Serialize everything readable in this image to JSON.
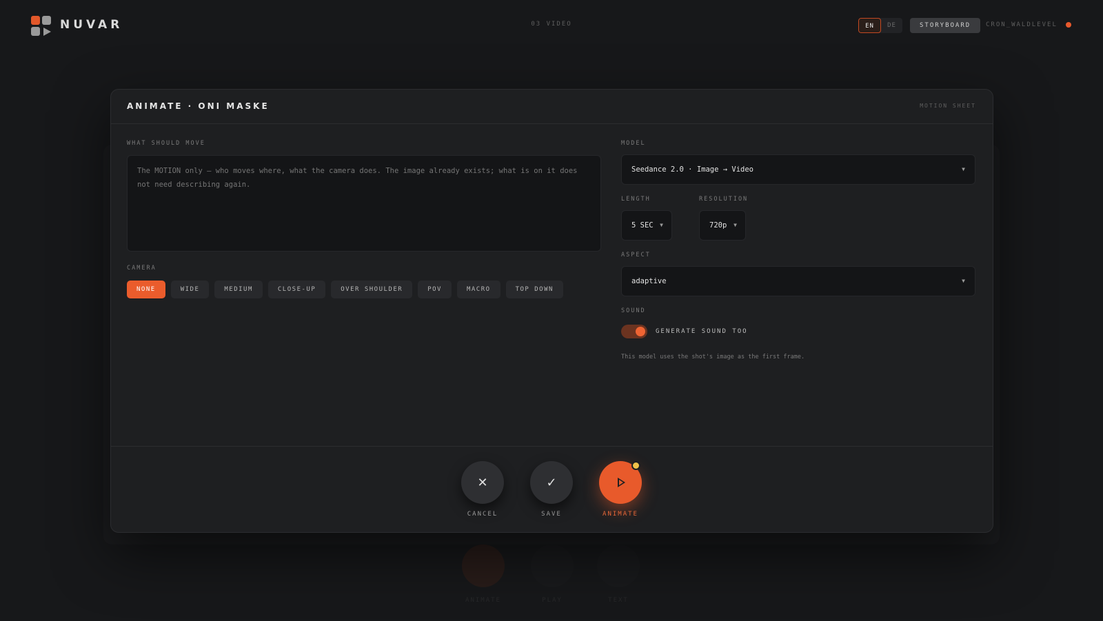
{
  "topbar": {
    "brand": "NUVAR",
    "crumb": "03 VIDEO",
    "lang_active": "EN",
    "lang_inactive": "DE",
    "storyboard_label": "STORYBOARD",
    "user": "CRON_WALDLEVEL",
    "accent": "#e8592c"
  },
  "modal": {
    "title": "ANIMATE · ONI MASKE",
    "tag": "MOTION SHEET",
    "motion_label": "WHAT SHOULD MOVE",
    "motion_placeholder": "The MOTION only — who moves where, what the camera does. The image already exists; what is on it does not need describing again.",
    "camera_label": "CAMERA",
    "camera_options": [
      "NONE",
      "WIDE",
      "MEDIUM",
      "CLOSE-UP",
      "OVER SHOULDER",
      "POV",
      "MACRO",
      "TOP DOWN"
    ],
    "camera_selected": "NONE",
    "model_label": "MODEL",
    "model_value": "Seedance 2.0 · Image → Video",
    "length_label": "LENGTH",
    "length_value": "5 SEC",
    "resolution_label": "RESOLUTION",
    "resolution_value": "720p",
    "aspect_label": "ASPECT",
    "aspect_value": "adaptive",
    "sound_label": "SOUND",
    "sound_toggle_label": "GENERATE SOUND TOO",
    "sound_enabled": true,
    "note": "This model uses the shot's image as the first frame."
  },
  "actions": {
    "cancel": "CANCEL",
    "save": "SAVE",
    "animate": "ANIMATE"
  },
  "background_actions": {
    "animate": "ANIMATE",
    "play": "PLAY",
    "text": "TEXT"
  }
}
